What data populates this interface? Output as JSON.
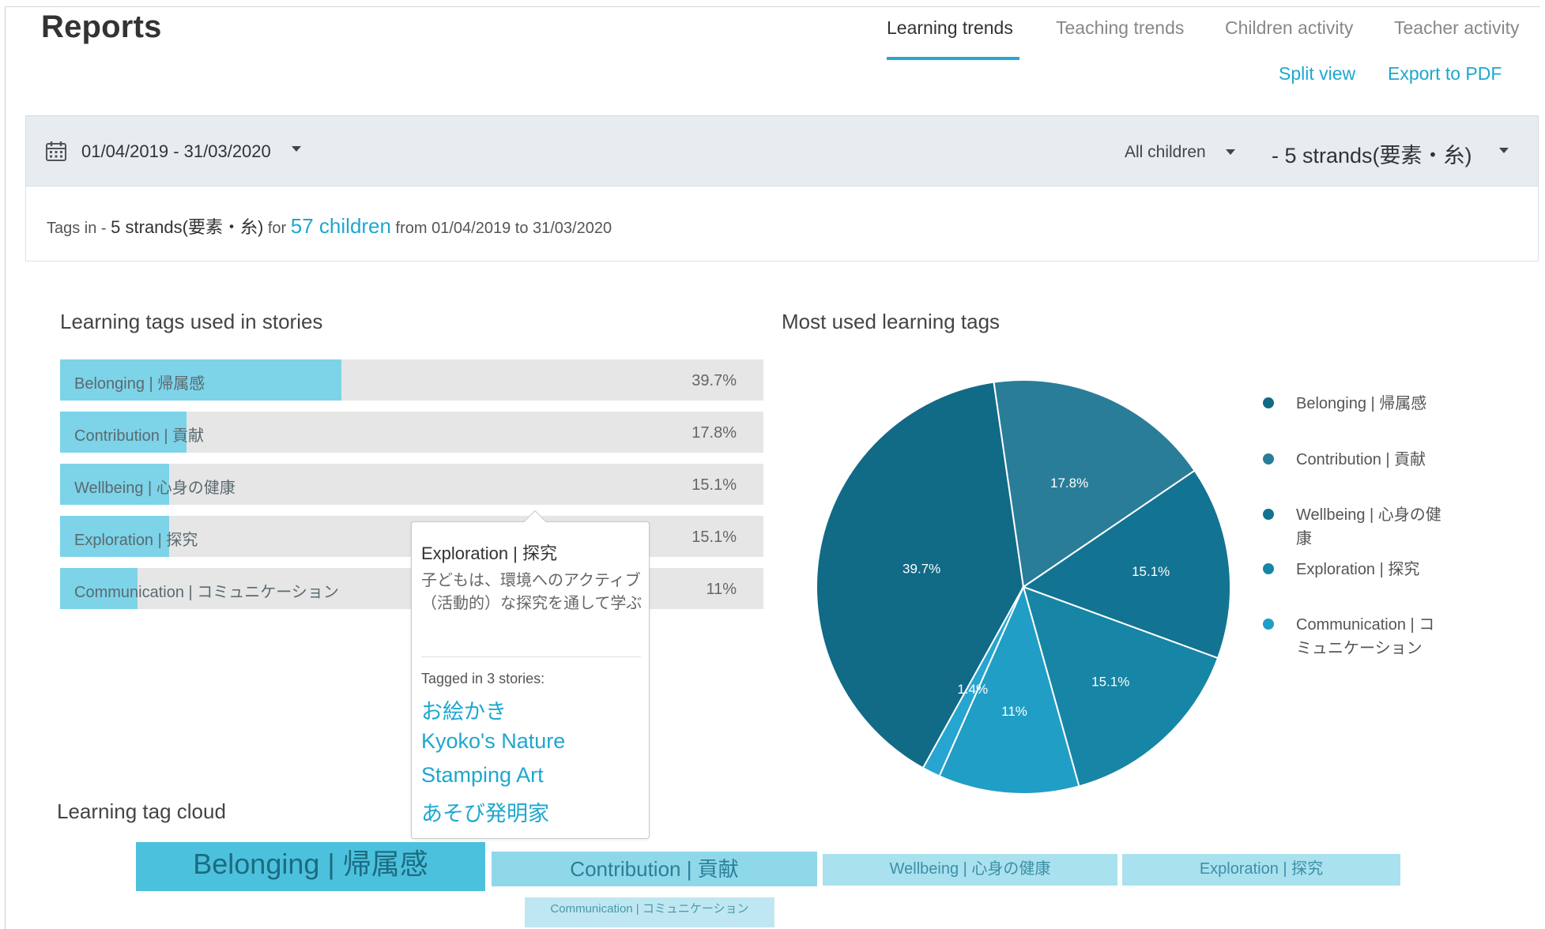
{
  "header": {
    "title": "Reports",
    "tabs": [
      {
        "label": "Learning trends",
        "active": true
      },
      {
        "label": "Teaching trends",
        "active": false
      },
      {
        "label": "Children activity",
        "active": false
      },
      {
        "label": "Teacher activity",
        "active": false
      }
    ],
    "actions": {
      "split_view": "Split view",
      "export_pdf": "Export to PDF"
    }
  },
  "filters": {
    "date_range": "01/04/2019 - 31/03/2020",
    "children": "All children",
    "strands": "- 5 strands(要素・糸)"
  },
  "summary": {
    "prefix": "Tags in -",
    "strands": "5 strands(要素・糸)",
    "for": "for",
    "children_count": "57 children",
    "range": "from 01/04/2019 to 31/03/2020"
  },
  "sections": {
    "bar_title": "Learning tags used in stories",
    "pie_title": "Most used learning tags",
    "cloud_title": "Learning tag cloud"
  },
  "tags": [
    {
      "label": "Belonging | 帰属感",
      "value_label": "39.7%",
      "fill": 0.4
    },
    {
      "label": "Contribution | 貢献",
      "value_label": "17.8%",
      "fill": 0.18
    },
    {
      "label": "Wellbeing | 心身の健康",
      "value_label": "15.1%",
      "fill": 0.155
    },
    {
      "label": "Exploration | 探究",
      "value_label": "15.1%",
      "fill": 0.155
    },
    {
      "label": "Communication | コミュニケーション",
      "value_label": "11%",
      "fill": 0.11
    }
  ],
  "tooltip": {
    "title": "Exploration | 探究",
    "description": "子どもは、環境へのアクティブ（活動的）な探究を通して学ぶ",
    "tagged": "Tagged in 3 stories:",
    "stories": [
      "お絵かき",
      "Kyoko's Nature",
      "Stamping Art",
      "あそび発明家"
    ]
  },
  "chart_data": {
    "type": "pie",
    "title": "Most used learning tags",
    "slices": [
      {
        "label": "Belonging | 帰属感",
        "value": 39.7,
        "display": "39.7%",
        "color": "#116a86"
      },
      {
        "label": "Contribution | 貢献",
        "value": 17.8,
        "display": "17.8%",
        "color": "#2a7d98"
      },
      {
        "label": "Wellbeing | 心身の健康",
        "value": 15.1,
        "display": "15.1%",
        "color": "#137392"
      },
      {
        "label": "Exploration | 探究",
        "value": 15.1,
        "display": "15.1%",
        "color": "#1785a5"
      },
      {
        "label": "Communication | コミュニケーション",
        "value": 11,
        "display": "11%",
        "color": "#209ec6"
      },
      {
        "label": "",
        "value": 1.4,
        "display": "1.4%",
        "color": "#25a5cf"
      }
    ],
    "legend_position": "right"
  },
  "legend": [
    {
      "label": "Belonging | 帰属感",
      "color": "#116a86"
    },
    {
      "label": "Contribution | 貢献",
      "color": "#2a7d98"
    },
    {
      "label": "Wellbeing | 心身の健康",
      "color": "#137392"
    },
    {
      "label": "Exploration | 探究",
      "color": "#1785a5"
    },
    {
      "label": "Communication | コミュニケーション",
      "color": "#209ec6"
    }
  ],
  "cloud": [
    {
      "label": "Belonging | 帰属感"
    },
    {
      "label": "Contribution | 貢献"
    },
    {
      "label": "Wellbeing | 心身の健康"
    },
    {
      "label": "Exploration | 探究"
    },
    {
      "label": "Communication | コミュニケーション"
    }
  ],
  "colors": {
    "accent": "#1ea7cf",
    "bar_fill": "#7dd3e8",
    "bar_track": "#e6e6e6",
    "filter_bg": "#e7ecf1"
  }
}
